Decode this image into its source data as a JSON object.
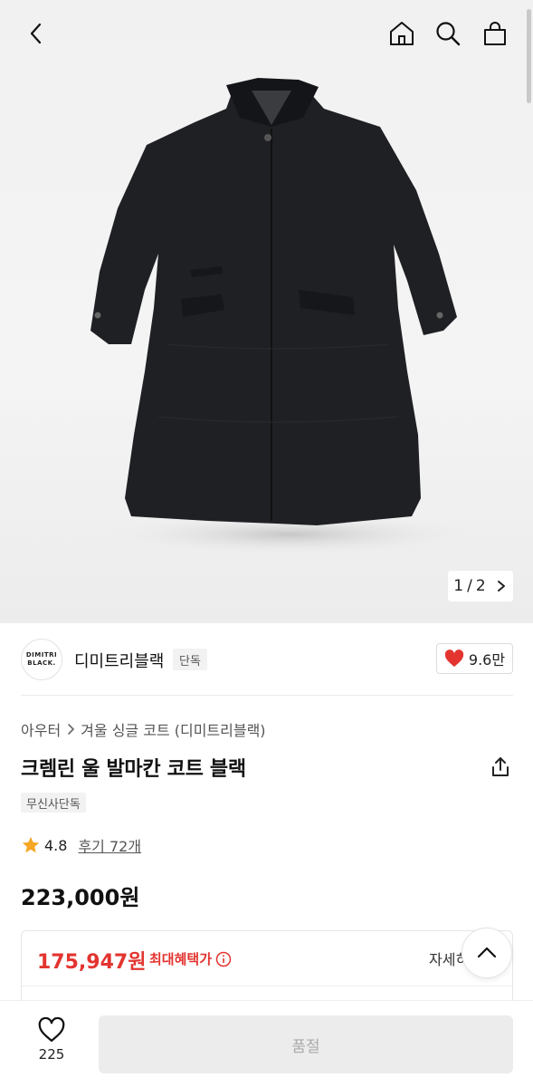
{
  "header": {
    "back_icon": "chevron-left-icon",
    "home_icon": "home-icon",
    "search_icon": "search-icon",
    "cart_icon": "shopping-bag-icon"
  },
  "gallery": {
    "current": "1",
    "separator": "/",
    "total": "2"
  },
  "brand": {
    "logo_line1": "DIMITRI",
    "logo_line2": "BLACK.",
    "name": "디미트리블랙",
    "exclusive_tag": "단독",
    "likes": "9.6만",
    "like_color": "#e3342f"
  },
  "breadcrumb": {
    "category": "아우터",
    "subcategory": "겨울 싱글 코트 (디미트리블랙)"
  },
  "product": {
    "title": "크렘린 울 발마칸 코트 블랙",
    "badge": "무신사단독",
    "rating": "4.8",
    "reviews": "후기 72개",
    "price": "223,000원"
  },
  "benefit": {
    "price": "175,947원",
    "label": "최대혜택가",
    "detail": "자세히",
    "accent": "#e3342f"
  },
  "bottom": {
    "wish_count": "225",
    "soldout_label": "품절"
  }
}
